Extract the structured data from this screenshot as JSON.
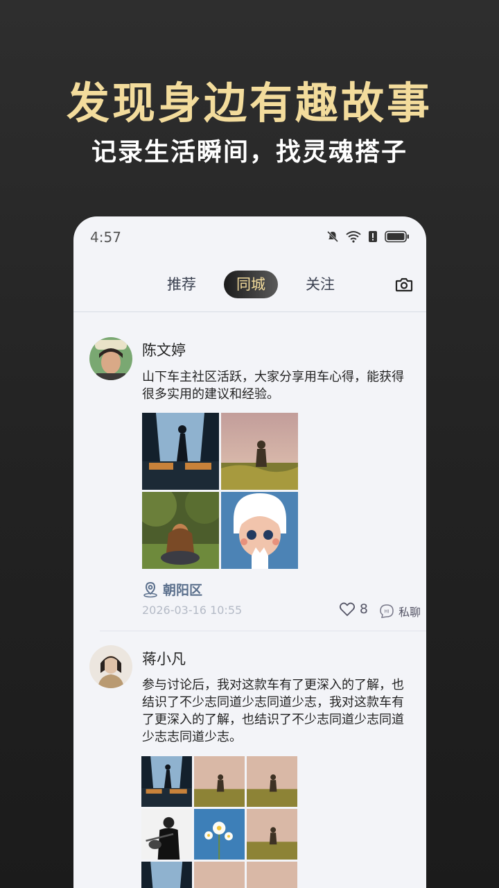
{
  "promo": {
    "headline": "发现身边有趣故事",
    "subline": "记录生活瞬间，找灵魂搭子"
  },
  "status_bar": {
    "time": "4:57",
    "icons": [
      "mute-bell-icon",
      "wifi-icon",
      "alert-icon",
      "battery-icon"
    ]
  },
  "tabs": [
    {
      "label": "推荐",
      "active": false
    },
    {
      "label": "同城",
      "active": true
    },
    {
      "label": "关注",
      "active": false
    }
  ],
  "colors": {
    "accent_gold": "#f3dc9c",
    "background": "#f3f4f8",
    "location": "#5a6f8c"
  },
  "posts": [
    {
      "username": "陈文婷",
      "content": "山下车主社区活跃，大家分享用车心得，能获得很多实用的建议和经验。",
      "location": "朝阳区",
      "time": "2026-03-16 10:55",
      "likes": "8",
      "chat_label": "私聊"
    },
    {
      "username": "蒋小凡",
      "content": "参与讨论后，我对这款车有了更深入的了解，也结识了不少志同道少志同道少志，我对这款车有了更深入的了解，也结识了不少志同道少志同道少志志同道少志。"
    }
  ]
}
